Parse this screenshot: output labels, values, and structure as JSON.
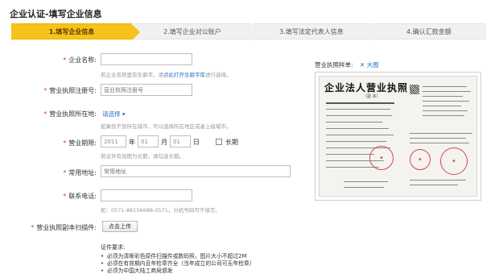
{
  "page": {
    "title": "企业认证-填写企业信息"
  },
  "steps": [
    {
      "label": "1.填写企业信息",
      "active": true
    },
    {
      "label": "2.填写企业对公账户",
      "active": false
    },
    {
      "label": "3.填写法定代表人信息",
      "active": false
    },
    {
      "label": "4.确认汇款金额",
      "active": false
    }
  ],
  "form": {
    "required_mark": "*",
    "company_name": {
      "label": "企业名称:",
      "value": "",
      "hint_before": "若企业名称里有生僻字，请",
      "hint_link": "点此打开生僻字库",
      "hint_after": "进行选择。"
    },
    "license_no": {
      "label": "营业执照注册号:",
      "placeholder": "营业执照注册号"
    },
    "license_location": {
      "label": "营业执照所在地:",
      "select_text": "请选择",
      "hint": "如果找不到所在城市，可以选择所在地区或者上级城市。"
    },
    "business_term": {
      "label": "营业期限:",
      "year": "2011",
      "year_unit": "年",
      "month": "01",
      "month_unit": "月",
      "day": "01",
      "day_unit": "日",
      "long_term": "长期",
      "hint": "若证件有效期为长期，请勾选长期。"
    },
    "address": {
      "label": "常用地址:",
      "placeholder": "常用地址"
    },
    "phone": {
      "label": "联系电话:",
      "value": "",
      "hint": "如：0571-88156688-0571，分机号码可不填写。"
    },
    "scan": {
      "label": "营业执照副本扫描件:",
      "button": "点击上传"
    }
  },
  "requirements": {
    "title": "证件要求:",
    "items": [
      "必须为清晰彩色原件扫描件或数码照，图片大小不超过2M",
      "必须在有效期内且年检章齐全（当年成立的公司可无年检章）",
      "必须为中国大陆工商局颁发"
    ]
  },
  "sample": {
    "label": "营业执照样单:",
    "zoom_link": "✕ 大图",
    "doc_title": "企业法人营业执照",
    "doc_sub": "（副  本）"
  }
}
